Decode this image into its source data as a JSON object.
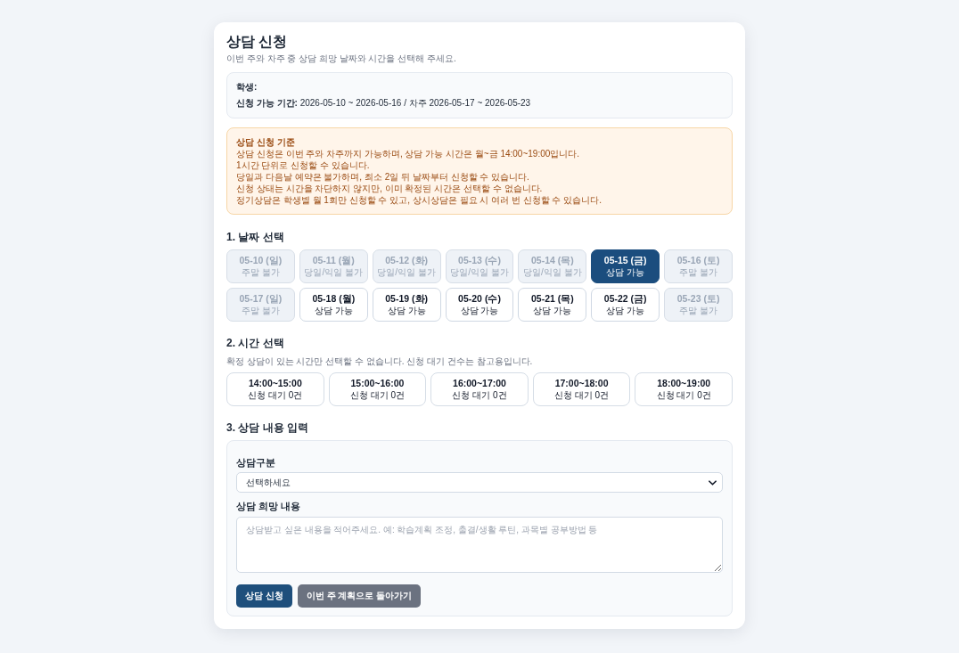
{
  "page": {
    "title": "상담 신청",
    "subtitle": "이번 주와 차주 중 상담 희망 날짜와 시간을 선택해 주세요."
  },
  "info": {
    "rows": [
      {
        "label": "학생:"
      },
      {
        "label": "신청 가능 기간:",
        "value": "2026-05-10 ~ 2026-05-16 / 차주 2026-05-17 ~ 2026-05-23"
      }
    ]
  },
  "notice": {
    "title": "상담 신청 기준",
    "lines": [
      "상담 신청은 이번 주와 차주까지 가능하며, 상담 가능 시간은 월~금 14:00~19:00입니다.",
      "1시간 단위로 신청할 수 있습니다.",
      "당일과 다음날 예약은 불가하며, 최소 2일 뒤 날짜부터 신청할 수 있습니다.",
      "신청 상태는 시간을 차단하지 않지만, 이미 확정된 시간은 선택할 수 없습니다.",
      "정기상담은 학생별 월 1회만 신청할 수 있고, 상시상담은 필요 시 여러 번 신청할 수 있습니다."
    ]
  },
  "date_section": {
    "heading": "1. 날짜 선택",
    "dates": [
      {
        "date": "05-10 (일)",
        "status": "주말 불가",
        "disabled": true,
        "selected": false
      },
      {
        "date": "05-11 (월)",
        "status": "당일/익일 불가",
        "disabled": true,
        "selected": false
      },
      {
        "date": "05-12 (화)",
        "status": "당일/익일 불가",
        "disabled": true,
        "selected": false
      },
      {
        "date": "05-13 (수)",
        "status": "당일/익일 불가",
        "disabled": true,
        "selected": false
      },
      {
        "date": "05-14 (목)",
        "status": "당일/익일 불가",
        "disabled": true,
        "selected": false
      },
      {
        "date": "05-15 (금)",
        "status": "상담 가능",
        "disabled": false,
        "selected": true
      },
      {
        "date": "05-16 (토)",
        "status": "주말 불가",
        "disabled": true,
        "selected": false
      },
      {
        "date": "05-17 (일)",
        "status": "주말 불가",
        "disabled": true,
        "selected": false
      },
      {
        "date": "05-18 (월)",
        "status": "상담 가능",
        "disabled": false,
        "selected": false
      },
      {
        "date": "05-19 (화)",
        "status": "상담 가능",
        "disabled": false,
        "selected": false
      },
      {
        "date": "05-20 (수)",
        "status": "상담 가능",
        "disabled": false,
        "selected": false
      },
      {
        "date": "05-21 (목)",
        "status": "상담 가능",
        "disabled": false,
        "selected": false
      },
      {
        "date": "05-22 (금)",
        "status": "상담 가능",
        "disabled": false,
        "selected": false
      },
      {
        "date": "05-23 (토)",
        "status": "주말 불가",
        "disabled": true,
        "selected": false
      }
    ]
  },
  "time_section": {
    "heading": "2. 시간 선택",
    "hint": "확정 상담이 있는 시간만 선택할 수 없습니다. 신청 대기 건수는 참고용입니다.",
    "slots": [
      {
        "time": "14:00~15:00",
        "status": "신청 대기 0건",
        "selected": false
      },
      {
        "time": "15:00~16:00",
        "status": "신청 대기 0건",
        "selected": false
      },
      {
        "time": "16:00~17:00",
        "status": "신청 대기 0건",
        "selected": false
      },
      {
        "time": "17:00~18:00",
        "status": "신청 대기 0건",
        "selected": false
      },
      {
        "time": "18:00~19:00",
        "status": "신청 대기 0건",
        "selected": false
      }
    ]
  },
  "content_section": {
    "heading": "3. 상담 내용 입력",
    "fields": [
      {
        "kind": "select",
        "label": "상담구분",
        "value": "선택하세요"
      },
      {
        "kind": "textarea",
        "label": "상담 희망 내용",
        "placeholder": "상담받고 싶은 내용을 적어주세요. 예: 학습계획 조정, 출결/생활 루틴, 과목별 공부방법 등"
      }
    ],
    "buttons": [
      {
        "label": "상담 신청",
        "kind": "primary"
      },
      {
        "label": "이번 주 계획으로 돌아가기",
        "kind": "secondary"
      }
    ]
  }
}
